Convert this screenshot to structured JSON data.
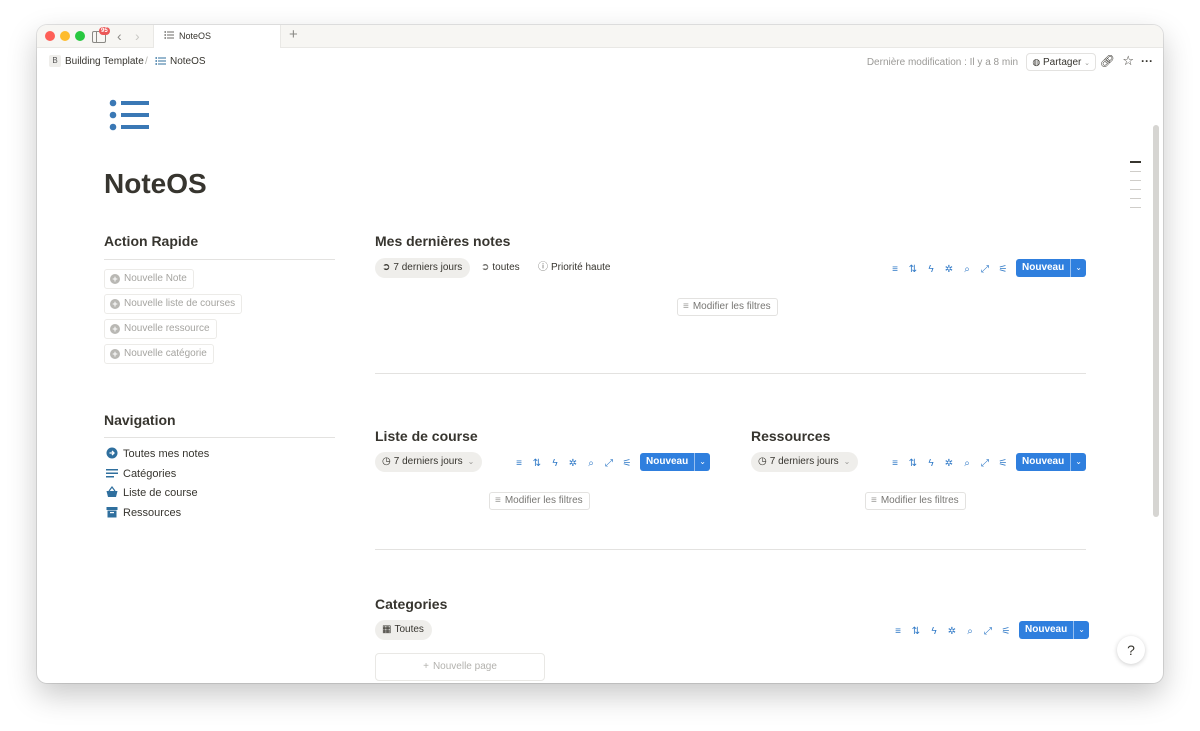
{
  "window": {
    "notification_count": "95",
    "tab_title": "NoteOS"
  },
  "breadcrumb": {
    "workspace_initial": "B",
    "workspace": "Building Template",
    "separator": "/",
    "page": "NoteOS"
  },
  "topbar": {
    "last_modified": "Dernière modification : Il y a 8 min",
    "share_label": "Partager"
  },
  "page": {
    "title": "NoteOS",
    "icon": "bulleted-list-icon"
  },
  "quick_actions": {
    "heading": "Action Rapide",
    "items": [
      "Nouvelle Note",
      "Nouvelle liste de courses",
      "Nouvelle ressource",
      "Nouvelle catégorie"
    ]
  },
  "navigation": {
    "heading": "Navigation",
    "items": [
      {
        "label": "Toutes mes notes",
        "icon": "circle-arrow-icon",
        "color": "#2f6f9e"
      },
      {
        "label": "Catégories",
        "icon": "lines-icon",
        "color": "#2f6f9e"
      },
      {
        "label": "Liste de course",
        "icon": "basket-icon",
        "color": "#2f6f9e"
      },
      {
        "label": "Ressources",
        "icon": "archive-icon",
        "color": "#2f6f9e"
      }
    ]
  },
  "recent_notes": {
    "heading": "Mes dernières notes",
    "views": [
      "7 derniers jours",
      "toutes",
      "Priorité haute"
    ],
    "new_label": "Nouveau",
    "filters_label": "Modifier les filtres"
  },
  "shopping_list": {
    "heading": "Liste de course",
    "view": "7 derniers jours",
    "new_label": "Nouveau",
    "filters_label": "Modifier les filtres"
  },
  "resources": {
    "heading": "Ressources",
    "view": "7 derniers jours",
    "new_label": "Nouveau",
    "filters_label": "Modifier les filtres"
  },
  "categories": {
    "heading": "Categories",
    "view": "Toutes",
    "new_label": "Nouveau",
    "new_page_label": "Nouvelle page"
  },
  "colors": {
    "accent": "#2f7fde",
    "icon_blue": "#2f6f9e"
  }
}
